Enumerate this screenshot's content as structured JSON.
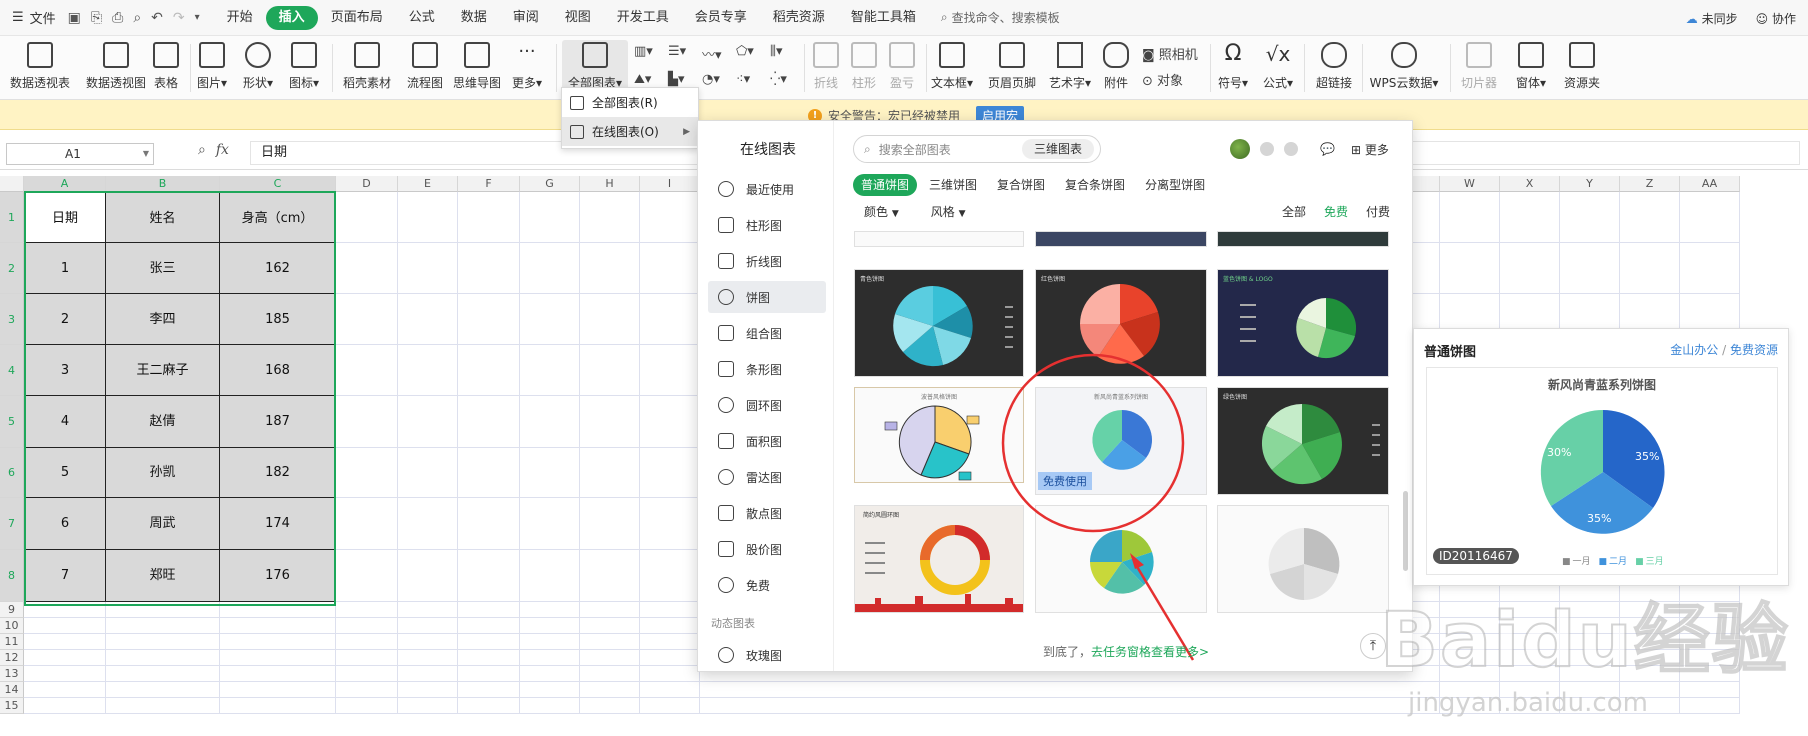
{
  "menubar": {
    "file": "文件",
    "tabs": [
      "开始",
      "插入",
      "页面布局",
      "公式",
      "数据",
      "审阅",
      "视图",
      "开发工具",
      "会员专享",
      "稻壳资源",
      "智能工具箱"
    ],
    "active_tab": "插入",
    "search": "查找命令、搜索模板",
    "sync": "未同步",
    "collab": "协作"
  },
  "ribbon": {
    "items": [
      "数据透视表",
      "数据透视图",
      "表格",
      "图片",
      "形状",
      "图标",
      "稻壳素材",
      "流程图",
      "思维导图",
      "更多",
      "全部图表",
      "折线",
      "柱形",
      "盈亏",
      "文本框",
      "页眉页脚",
      "艺术字",
      "附件",
      "照相机",
      "对象",
      "符号",
      "公式",
      "超链接",
      "WPS云数据",
      "切片器",
      "窗体",
      "资源夹"
    ]
  },
  "dropdown": {
    "all_charts": "全部图表(R)",
    "online_charts": "在线图表(O)"
  },
  "security": {
    "message": "安全警告：宏已经被禁用",
    "enable": "启用宏"
  },
  "formula": {
    "namebox": "A1",
    "fx": "fx",
    "value": "日期"
  },
  "columns": [
    "A",
    "B",
    "C",
    "D",
    "E",
    "F",
    "G",
    "H",
    "I",
    "V",
    "W",
    "X",
    "Y",
    "Z",
    "AA"
  ],
  "rows": [
    "1",
    "2",
    "3",
    "4",
    "5",
    "6",
    "7",
    "8",
    "9",
    "10",
    "11",
    "12",
    "13",
    "14",
    "15"
  ],
  "table": {
    "header": [
      "日期",
      "姓名",
      "身高（cm）"
    ],
    "rows": [
      [
        "1",
        "张三",
        "162"
      ],
      [
        "2",
        "李四",
        "185"
      ],
      [
        "3",
        "王二麻子",
        "168"
      ],
      [
        "4",
        "赵倩",
        "187"
      ],
      [
        "5",
        "孙凯",
        "182"
      ],
      [
        "6",
        "周武",
        "174"
      ],
      [
        "7",
        "郑旺",
        "176"
      ]
    ]
  },
  "panel": {
    "title": "在线图表",
    "nav": [
      "最近使用",
      "柱形图",
      "折线图",
      "饼图",
      "组合图",
      "条形图",
      "圆环图",
      "面积图",
      "雷达图",
      "散点图",
      "股价图",
      "免费"
    ],
    "nav_group": "动态图表",
    "nav_extra": "玫瑰图",
    "search_placeholder": "搜索全部图表",
    "search_tag": "三维图表",
    "more": "更多",
    "tabs": [
      "普通饼图",
      "三维饼图",
      "复合饼图",
      "复合条饼图",
      "分离型饼图"
    ],
    "filters": [
      "颜色",
      "风格"
    ],
    "price": [
      "全部",
      "免费",
      "付费"
    ],
    "thumbs": {
      "t1": "青色饼图",
      "t2": "红色饼图",
      "t3": "蓝色饼图 & LOGO",
      "t4": "波普风格饼图",
      "t5": "新风尚青蓝系列饼图",
      "t6": "绿色饼图",
      "t7": "简约风圆环图"
    },
    "free_use": "免费使用",
    "footer_prefix": "到底了，",
    "footer_link": "去任务窗格查看更多>"
  },
  "preview": {
    "title": "普通饼图",
    "source_a": "金山办公",
    "source_b": "免费资源",
    "chart_title": "新风尚青蓝系列饼图",
    "id": "ID20116467",
    "legend": [
      "一月",
      "二月",
      "三月"
    ],
    "values": [
      "35%",
      "35%",
      "30%"
    ]
  },
  "watermark": {
    "logo": "Baidu经验",
    "url": "jingyan.baidu.com"
  },
  "colors": {
    "accent": "#1ea75a",
    "selection": "#1ea75a",
    "annotation": "#e53030"
  }
}
